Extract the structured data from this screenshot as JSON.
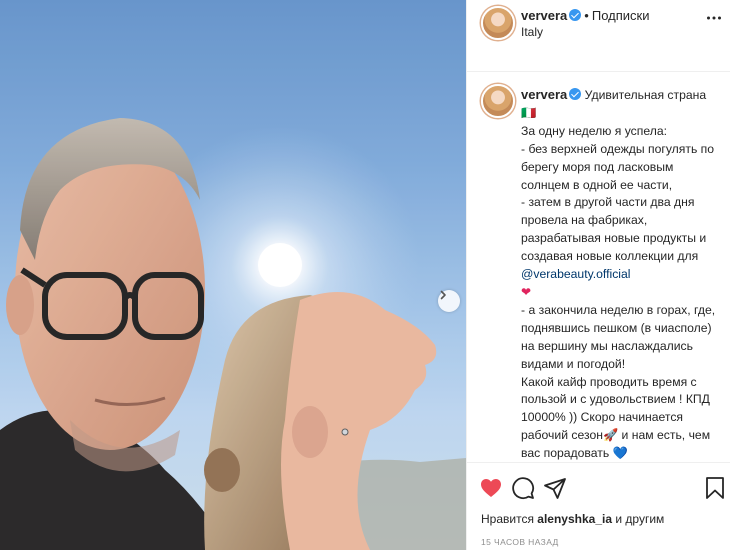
{
  "post": {
    "username": "ververa",
    "separator": "•",
    "follow_label": "Подписки",
    "location": "Italy",
    "caption": {
      "lead": "Удивительная страна 🇮🇹",
      "body_1": "\nЗа одну неделю я успела:\n- без верхней одежды погулять по берегу моря под ласковым солнцем в одной ее части,\n- затем в другой части два дня провела на фабриках, разрабатывая новые продукты и создавая новые коллекции для ",
      "mention": "@verabeauty.official",
      "heart": "❤",
      "body_2": "\n- а закончила неделю в горах, где, поднявшись пешком (в чиаcполе) на вершину мы наслаждались видами и погодой!\nКакой кайф проводить время с пользой и с удовольствием ! КПД 10000% )) Скоро начинается рабочий сезон🚀 и нам есть, чем вас порадовать 💙"
    },
    "likes": {
      "prefix": "Нравится",
      "user": "alenyshka_ia",
      "suffix": "и другим"
    },
    "time_ago": "15 ЧАСОВ НАЗАД"
  },
  "icons": {
    "like": "heart-filled-icon",
    "comment": "comment-icon",
    "share": "paper-plane-icon",
    "save": "bookmark-icon",
    "more": "ellipsis-icon",
    "next": "chevron-right-icon"
  },
  "colors": {
    "like_red": "#ed4956",
    "verified_blue": "#3897f0",
    "mention_blue": "#00376b"
  }
}
